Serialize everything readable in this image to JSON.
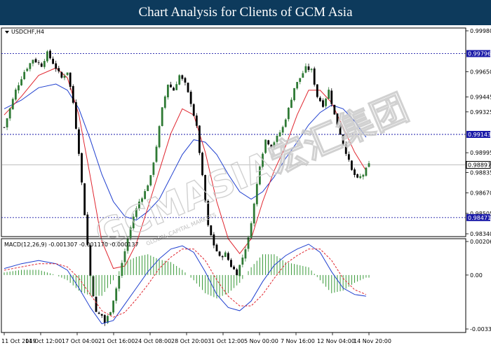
{
  "banner": {
    "title": "Chart Analysis for Clients of GCM Asia"
  },
  "watermark": {
    "text": "GCMASIA宏汇集团",
    "subtext": "GLOBAL CAPITAL MARKETS"
  },
  "colors": {
    "bull": "#2f7a35",
    "bear": "#000000",
    "ma_fast": "#e0262f",
    "ma_slow": "#1f3fcf",
    "level": "#1a1aa8",
    "macd_line": "#1f3fcf",
    "macd_signal": "#e0262f",
    "macd_hist": "#3a9a3a"
  },
  "chart_data": [
    {
      "type": "line",
      "title": "USDCHF,H4",
      "ylim": [
        0.9834,
        0.9998
      ],
      "y_ticks": [
        "0.99980",
        "0.99650",
        "0.99445",
        "0.99325",
        "0.98995",
        "0.98835",
        "0.98670",
        "0.98505",
        "0.98340"
      ],
      "x_ticks": [
        "11 Oct 2019",
        "14 Oct 12:00",
        "17 Oct 04:00",
        "21 Oct 16:00",
        "24 Oct 08:00",
        "28 Oct 20:00",
        "31 Oct 12:00",
        "5 Nov 00:00",
        "7 Nov 16:00",
        "12 Nov 04:00",
        "14 Nov 20:00"
      ],
      "levels": [
        {
          "value": 0.99796,
          "label": "0.99796"
        },
        {
          "value": 0.99143,
          "label": "0.99143"
        },
        {
          "value": 0.98897,
          "label": "0.98897"
        },
        {
          "value": 0.98471,
          "label": "0.98471"
        }
      ],
      "close_path": [
        [
          0,
          0.992
        ],
        [
          4,
          0.995
        ],
        [
          7,
          0.9965
        ],
        [
          10,
          0.9975
        ],
        [
          13,
          0.997
        ],
        [
          15,
          0.998
        ],
        [
          17,
          0.9972
        ],
        [
          20,
          0.996
        ],
        [
          22,
          0.9965
        ],
        [
          24,
          0.994
        ],
        [
          26,
          0.99
        ],
        [
          28,
          0.985
        ],
        [
          30,
          0.98
        ],
        [
          32,
          0.977
        ],
        [
          34,
          0.9768
        ],
        [
          35,
          0.9762
        ],
        [
          37,
          0.9772
        ],
        [
          39,
          0.979
        ],
        [
          41,
          0.981
        ],
        [
          43,
          0.983
        ],
        [
          45,
          0.9848
        ],
        [
          47,
          0.986
        ],
        [
          49,
          0.9868
        ],
        [
          51,
          0.988
        ],
        [
          53,
          0.9905
        ],
        [
          55,
          0.9935
        ],
        [
          57,
          0.9955
        ],
        [
          59,
          0.995
        ],
        [
          61,
          0.9962
        ],
        [
          63,
          0.9955
        ],
        [
          65,
          0.994
        ],
        [
          67,
          0.992
        ],
        [
          69,
          0.988
        ],
        [
          71,
          0.984
        ],
        [
          73,
          0.9825
        ],
        [
          75,
          0.9815
        ],
        [
          77,
          0.9818
        ],
        [
          79,
          0.9808
        ],
        [
          81,
          0.9802
        ],
        [
          83,
          0.9815
        ],
        [
          85,
          0.983
        ],
        [
          87,
          0.9858
        ],
        [
          89,
          0.989
        ],
        [
          91,
          0.991
        ],
        [
          93,
          0.9905
        ],
        [
          95,
          0.9912
        ],
        [
          97,
          0.992
        ],
        [
          99,
          0.9935
        ],
        [
          101,
          0.9952
        ],
        [
          103,
          0.996
        ],
        [
          105,
          0.9968
        ],
        [
          107,
          0.9966
        ],
        [
          109,
          0.9945
        ],
        [
          111,
          0.9938
        ],
        [
          113,
          0.995
        ],
        [
          115,
          0.993
        ],
        [
          117,
          0.9915
        ],
        [
          119,
          0.99
        ],
        [
          121,
          0.9885
        ],
        [
          123,
          0.9878
        ],
        [
          125,
          0.9882
        ],
        [
          127,
          0.989
        ]
      ],
      "ma_fast_path": [
        [
          0,
          0.993
        ],
        [
          6,
          0.9945
        ],
        [
          12,
          0.9962
        ],
        [
          18,
          0.9968
        ],
        [
          22,
          0.996
        ],
        [
          26,
          0.993
        ],
        [
          30,
          0.988
        ],
        [
          34,
          0.9828
        ],
        [
          38,
          0.9806
        ],
        [
          42,
          0.9808
        ],
        [
          46,
          0.9826
        ],
        [
          50,
          0.9855
        ],
        [
          54,
          0.9885
        ],
        [
          58,
          0.9915
        ],
        [
          62,
          0.9935
        ],
        [
          66,
          0.993
        ],
        [
          70,
          0.99
        ],
        [
          74,
          0.986
        ],
        [
          78,
          0.983
        ],
        [
          82,
          0.9818
        ],
        [
          86,
          0.983
        ],
        [
          90,
          0.986
        ],
        [
          94,
          0.9885
        ],
        [
          98,
          0.9905
        ],
        [
          102,
          0.993
        ],
        [
          106,
          0.995
        ],
        [
          110,
          0.995
        ],
        [
          114,
          0.994
        ],
        [
          118,
          0.992
        ],
        [
          122,
          0.99
        ],
        [
          126,
          0.9885
        ]
      ],
      "ma_slow_path": [
        [
          0,
          0.9935
        ],
        [
          6,
          0.9942
        ],
        [
          12,
          0.9952
        ],
        [
          18,
          0.9955
        ],
        [
          22,
          0.995
        ],
        [
          26,
          0.9935
        ],
        [
          30,
          0.991
        ],
        [
          34,
          0.9882
        ],
        [
          38,
          0.986
        ],
        [
          42,
          0.9848
        ],
        [
          46,
          0.9845
        ],
        [
          50,
          0.9852
        ],
        [
          54,
          0.9862
        ],
        [
          58,
          0.988
        ],
        [
          62,
          0.9898
        ],
        [
          66,
          0.991
        ],
        [
          70,
          0.9908
        ],
        [
          74,
          0.9898
        ],
        [
          78,
          0.9882
        ],
        [
          82,
          0.9868
        ],
        [
          86,
          0.9862
        ],
        [
          90,
          0.9868
        ],
        [
          94,
          0.988
        ],
        [
          98,
          0.9895
        ],
        [
          102,
          0.9908
        ],
        [
          106,
          0.9922
        ],
        [
          110,
          0.9932
        ],
        [
          114,
          0.9938
        ],
        [
          118,
          0.9935
        ],
        [
          122,
          0.9925
        ],
        [
          126,
          0.9912
        ]
      ]
    },
    {
      "type": "line",
      "title": "MACD(12,26,9) -0.001307 -0.001170 -0.000137",
      "ylim": [
        -0.003325,
        0.002067
      ],
      "y_ticks": [
        "0.002067",
        "0.00",
        "-0.003325"
      ],
      "zero_label": "0.00",
      "macd_path": [
        [
          0,
          0.0004
        ],
        [
          6,
          0.0007
        ],
        [
          12,
          0.0009
        ],
        [
          18,
          0.0007
        ],
        [
          22,
          0.0003
        ],
        [
          26,
          -0.0008
        ],
        [
          30,
          -0.002
        ],
        [
          34,
          -0.003
        ],
        [
          38,
          -0.0028
        ],
        [
          42,
          -0.0018
        ],
        [
          46,
          -0.0008
        ],
        [
          50,
          0.0002
        ],
        [
          54,
          0.001
        ],
        [
          58,
          0.0016
        ],
        [
          62,
          0.0018
        ],
        [
          66,
          0.0014
        ],
        [
          70,
          0.0002
        ],
        [
          74,
          -0.0012
        ],
        [
          78,
          -0.002
        ],
        [
          82,
          -0.0022
        ],
        [
          86,
          -0.0016
        ],
        [
          90,
          -0.0004
        ],
        [
          94,
          0.0006
        ],
        [
          98,
          0.0012
        ],
        [
          102,
          0.0016
        ],
        [
          106,
          0.0019
        ],
        [
          110,
          0.0014
        ],
        [
          114,
          0.0002
        ],
        [
          118,
          -0.0008
        ],
        [
          122,
          -0.0012
        ],
        [
          126,
          -0.0013
        ]
      ],
      "signal_path": [
        [
          0,
          0.0003
        ],
        [
          6,
          0.0005
        ],
        [
          12,
          0.0007
        ],
        [
          18,
          0.0007
        ],
        [
          22,
          0.0005
        ],
        [
          26,
          -0.0002
        ],
        [
          30,
          -0.0012
        ],
        [
          34,
          -0.0022
        ],
        [
          38,
          -0.0026
        ],
        [
          42,
          -0.0023
        ],
        [
          46,
          -0.0015
        ],
        [
          50,
          -0.0006
        ],
        [
          54,
          0.0004
        ],
        [
          58,
          0.0011
        ],
        [
          62,
          0.0016
        ],
        [
          66,
          0.0016
        ],
        [
          70,
          0.0009
        ],
        [
          74,
          -0.0003
        ],
        [
          78,
          -0.0013
        ],
        [
          82,
          -0.0019
        ],
        [
          86,
          -0.0019
        ],
        [
          90,
          -0.0012
        ],
        [
          94,
          -0.0002
        ],
        [
          98,
          0.0007
        ],
        [
          102,
          0.0012
        ],
        [
          106,
          0.0016
        ],
        [
          110,
          0.0016
        ],
        [
          114,
          0.0009
        ],
        [
          118,
          -0.0002
        ],
        [
          122,
          -0.0009
        ],
        [
          126,
          -0.0012
        ]
      ]
    }
  ]
}
